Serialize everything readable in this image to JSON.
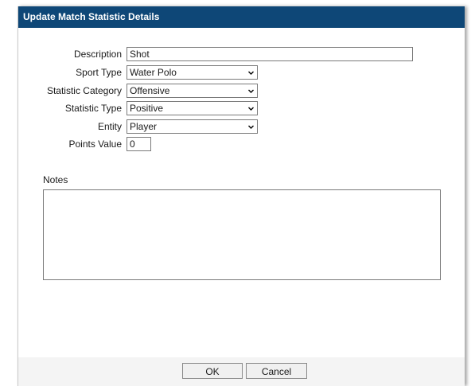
{
  "dialog": {
    "title": "Update Match Statistic Details"
  },
  "form": {
    "description": {
      "label": "Description",
      "value": "Shot"
    },
    "sport_type": {
      "label": "Sport Type",
      "value": "Water Polo"
    },
    "statistic_category": {
      "label": "Statistic Category",
      "value": "Offensive"
    },
    "statistic_type": {
      "label": "Statistic Type",
      "value": "Positive"
    },
    "entity": {
      "label": "Entity",
      "value": "Player"
    },
    "points_value": {
      "label": "Points Value",
      "value": "0"
    },
    "notes": {
      "label": "Notes",
      "value": ""
    }
  },
  "buttons": {
    "ok": "OK",
    "cancel": "Cancel"
  },
  "icons": {
    "dropdown": "chevron-down-icon"
  },
  "colors": {
    "titlebar": "#0e4777",
    "title_text": "#ffffff"
  }
}
